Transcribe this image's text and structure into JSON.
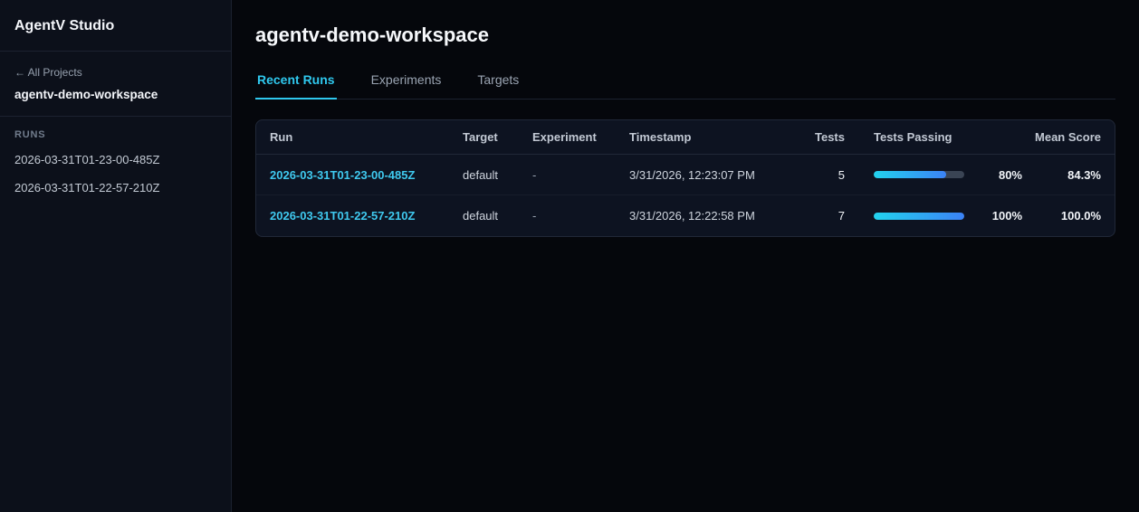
{
  "app": {
    "title": "AgentV Studio"
  },
  "sidebar": {
    "back_link": "← All Projects",
    "workspace": "agentv-demo-workspace",
    "section_label": "RUNS",
    "runs": [
      "2026-03-31T01-23-00-485Z",
      "2026-03-31T01-22-57-210Z"
    ]
  },
  "main": {
    "title": "agentv-demo-workspace",
    "tabs": [
      {
        "label": "Recent Runs"
      },
      {
        "label": "Experiments"
      },
      {
        "label": "Targets"
      }
    ]
  },
  "table": {
    "columns": [
      "Run",
      "Target",
      "Experiment",
      "Timestamp",
      "Tests",
      "Tests Passing",
      "Mean Score"
    ],
    "rows": [
      {
        "run": "2026-03-31T01-23-00-485Z",
        "target": "default",
        "experiment": "-",
        "timestamp": "3/31/2026, 12:23:07 PM",
        "tests": "5",
        "pass_pct": 80,
        "pass_label": "80%",
        "mean_score": "84.3%"
      },
      {
        "run": "2026-03-31T01-22-57-210Z",
        "target": "default",
        "experiment": "-",
        "timestamp": "3/31/2026, 12:22:58 PM",
        "tests": "7",
        "pass_pct": 100,
        "pass_label": "100%",
        "mean_score": "100.0%"
      }
    ]
  },
  "colors": {
    "accent": "#2fc8ee",
    "bar_gradient_from": "#22d3ee",
    "bar_gradient_to": "#3b82f6"
  }
}
